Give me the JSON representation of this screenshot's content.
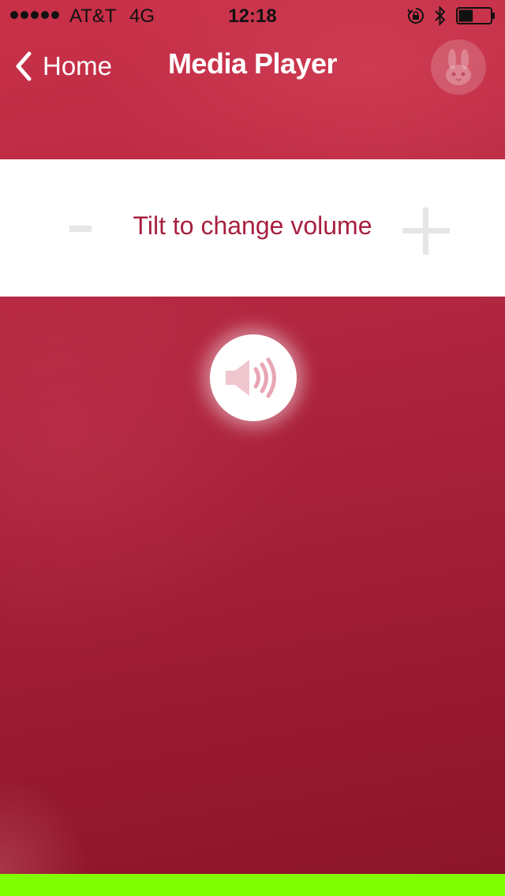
{
  "status_bar": {
    "carrier": "AT&T",
    "network": "4G",
    "time": "12:18",
    "signal_bars": 5,
    "battery_level": 0.45
  },
  "nav": {
    "back_label": "Home",
    "title": "Media Player",
    "back_icon": "chevron-left-icon",
    "avatar_icon": "bunny-icon"
  },
  "volume": {
    "label": "Tilt to change volume",
    "decrease_icon": "minus-icon",
    "increase_icon": "plus-icon"
  },
  "speaker": {
    "icon": "speaker-volume-icon"
  },
  "colors": {
    "background": "#b02540",
    "accent_text": "#a82040",
    "bottom_bar": "#7fff00",
    "strip": "#ffffff"
  }
}
